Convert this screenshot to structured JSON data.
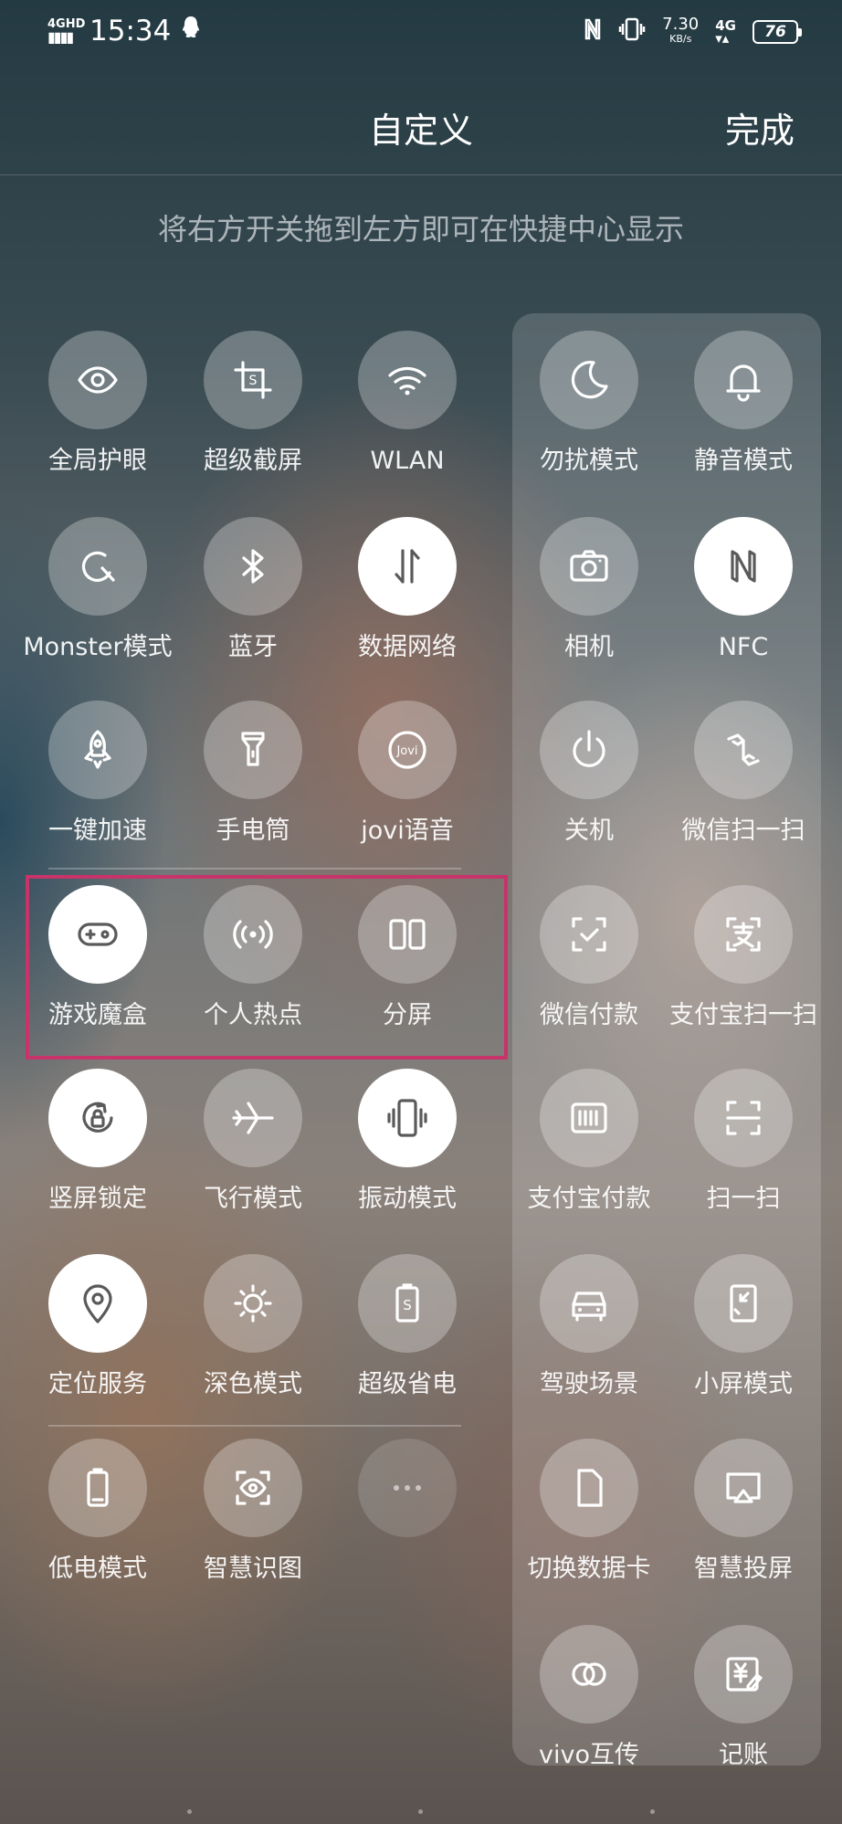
{
  "status_bar": {
    "network": "4GHD",
    "time": "15:34",
    "speed": "7.30",
    "speed_unit": "KB/s",
    "signal_type": "4G",
    "battery": "76"
  },
  "header": {
    "title": "自定义",
    "done_label": "完成"
  },
  "hint": "将右方开关拖到左方即可在快捷中心显示",
  "left_tiles": [
    {
      "label": "全局护眼",
      "icon": "eye-icon",
      "active": false
    },
    {
      "label": "超级截屏",
      "icon": "screenshot-crop-icon",
      "active": false
    },
    {
      "label": "WLAN",
      "icon": "wifi-icon",
      "active": false
    },
    {
      "label": "Monster模式",
      "icon": "monster-mode-icon",
      "active": false
    },
    {
      "label": "蓝牙",
      "icon": "bluetooth-icon",
      "active": false
    },
    {
      "label": "数据网络",
      "icon": "mobile-data-icon",
      "active": true
    },
    {
      "label": "一键加速",
      "icon": "rocket-icon",
      "active": false
    },
    {
      "label": "手电筒",
      "icon": "flashlight-icon",
      "active": false
    },
    {
      "label": "jovi语音",
      "icon": "jovi-icon",
      "active": false
    },
    {
      "label": "游戏魔盒",
      "icon": "gamepad-icon",
      "active": true
    },
    {
      "label": "个人热点",
      "icon": "hotspot-icon",
      "active": false
    },
    {
      "label": "分屏",
      "icon": "split-screen-icon",
      "active": false
    },
    {
      "label": "竖屏锁定",
      "icon": "rotation-lock-icon",
      "active": true
    },
    {
      "label": "飞行模式",
      "icon": "airplane-icon",
      "active": false
    },
    {
      "label": "振动模式",
      "icon": "vibrate-icon",
      "active": true
    },
    {
      "label": "定位服务",
      "icon": "location-icon",
      "active": true
    },
    {
      "label": "深色模式",
      "icon": "dark-mode-icon",
      "active": false
    },
    {
      "label": "超级省电",
      "icon": "super-power-save-icon",
      "active": false
    },
    {
      "label": "低电模式",
      "icon": "low-battery-icon",
      "active": false
    },
    {
      "label": "智慧识图",
      "icon": "smart-vision-icon",
      "active": false
    },
    {
      "label": "",
      "icon": "more-icon",
      "active": false
    }
  ],
  "right_tiles": [
    {
      "label": "勿扰模式",
      "icon": "moon-icon",
      "active": false
    },
    {
      "label": "静音模式",
      "icon": "bell-icon",
      "active": false
    },
    {
      "label": "相机",
      "icon": "camera-icon",
      "active": false
    },
    {
      "label": "NFC",
      "icon": "nfc-icon",
      "active": true
    },
    {
      "label": "关机",
      "icon": "power-icon",
      "active": false
    },
    {
      "label": "微信扫一扫",
      "icon": "wechat-scan-icon",
      "active": false
    },
    {
      "label": "微信付款",
      "icon": "wechat-pay-icon",
      "active": false
    },
    {
      "label": "支付宝扫一扫",
      "icon": "alipay-scan-icon",
      "active": false
    },
    {
      "label": "支付宝付款",
      "icon": "alipay-pay-icon",
      "active": false
    },
    {
      "label": "扫一扫",
      "icon": "scan-icon",
      "active": false
    },
    {
      "label": "驾驶场景",
      "icon": "car-icon",
      "active": false
    },
    {
      "label": "小屏模式",
      "icon": "small-screen-icon",
      "active": false
    },
    {
      "label": "切换数据卡",
      "icon": "sim-card-icon",
      "active": false
    },
    {
      "label": "智慧投屏",
      "icon": "screen-cast-icon",
      "active": false
    },
    {
      "label": "vivo互传",
      "icon": "vivo-share-icon",
      "active": false
    },
    {
      "label": "记账",
      "icon": "bookkeeping-icon",
      "active": false
    }
  ],
  "colors": {
    "highlight": "#c8336a",
    "tile_on": "#ffffff"
  }
}
